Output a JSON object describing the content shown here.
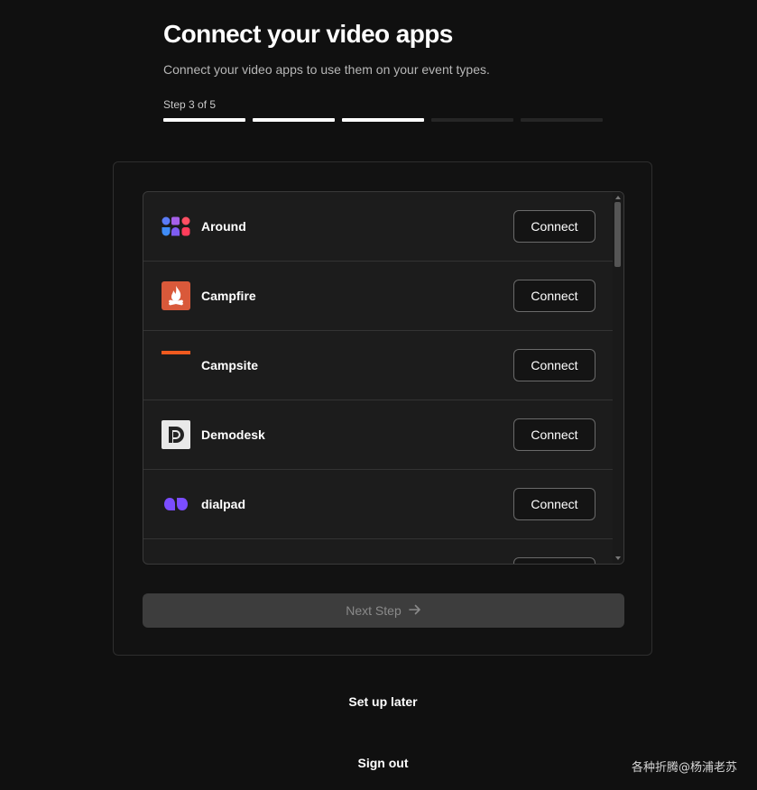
{
  "header": {
    "title": "Connect your video apps",
    "subtitle": "Connect your video apps to use them on your event types.",
    "step_label": "Step 3 of 5",
    "steps_total": 5,
    "steps_completed": 3
  },
  "apps": [
    {
      "name": "Around",
      "action": "Connect",
      "icon": "around-logo-icon"
    },
    {
      "name": "Campfire",
      "action": "Connect",
      "icon": "campfire-logo-icon"
    },
    {
      "name": "Campsite",
      "action": "Connect",
      "icon": "campsite-logo-icon"
    },
    {
      "name": "Demodesk",
      "action": "Connect",
      "icon": "demodesk-logo-icon"
    },
    {
      "name": "dialpad",
      "action": "Connect",
      "icon": "dialpad-logo-icon"
    }
  ],
  "next_button": {
    "label": "Next Step",
    "icon": "arrow-right-icon"
  },
  "links": {
    "setup_later": "Set up later",
    "sign_out": "Sign out"
  },
  "watermark": "各种折腾@杨浦老苏",
  "colors": {
    "background": "#101010",
    "accent": "#ffffff",
    "campfire": "#d9593a",
    "campsite": "#f05a1f",
    "dialpad": "#7b4dff"
  }
}
